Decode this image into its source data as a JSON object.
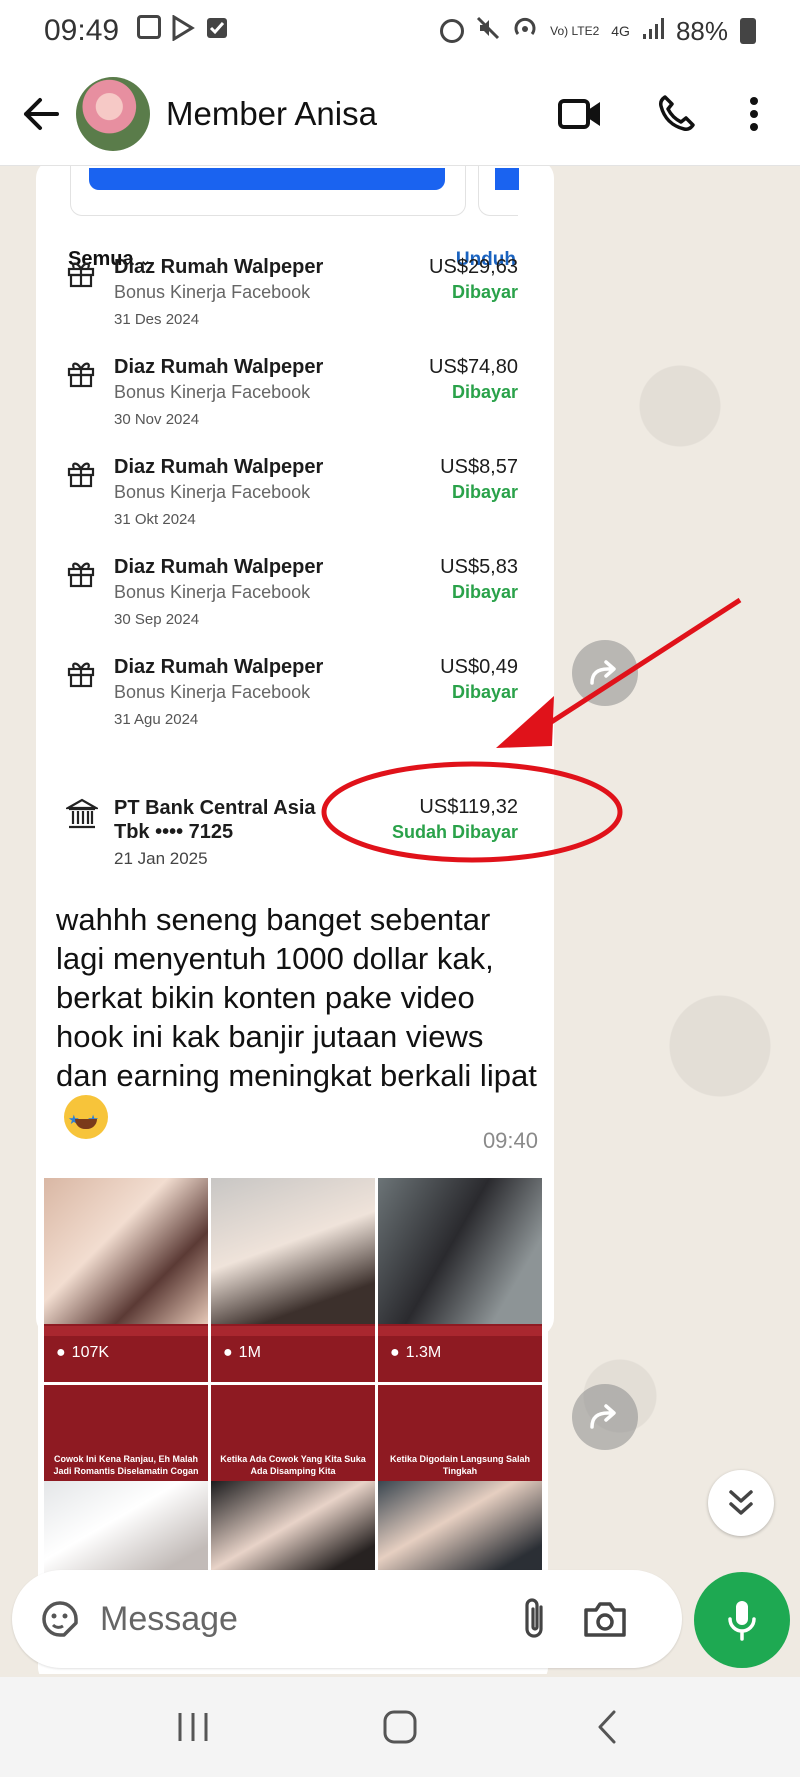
{
  "status_bar": {
    "time": "09:49",
    "network": "Vo) LTE2",
    "network_type": "4G",
    "battery": "88%"
  },
  "header": {
    "contact_name": "Member Anisa"
  },
  "shared_screenshot": {
    "filter_label": "Semua",
    "download_label": "Unduh",
    "transactions": [
      {
        "name": "Diaz Rumah Walpeper",
        "subtitle": "Bonus Kinerja Facebook",
        "date": "31 Des 2024",
        "amount": "US$29,63",
        "status": "Dibayar"
      },
      {
        "name": "Diaz Rumah Walpeper",
        "subtitle": "Bonus Kinerja Facebook",
        "date": "30 Nov 2024",
        "amount": "US$74,80",
        "status": "Dibayar"
      },
      {
        "name": "Diaz Rumah Walpeper",
        "subtitle": "Bonus Kinerja Facebook",
        "date": "31 Okt 2024",
        "amount": "US$8,57",
        "status": "Dibayar"
      },
      {
        "name": "Diaz Rumah Walpeper",
        "subtitle": "Bonus Kinerja Facebook",
        "date": "30 Sep 2024",
        "amount": "US$5,83",
        "status": "Dibayar"
      },
      {
        "name": "Diaz Rumah Walpeper",
        "subtitle": "Bonus Kinerja Facebook",
        "date": "31 Agu 2024",
        "amount": "US$0,49",
        "status": "Dibayar"
      }
    ],
    "payout": {
      "name": "PT Bank Central Asia Tbk •••• 7125",
      "date": "21 Jan 2025",
      "amount": "US$119,32",
      "status": "Sudah Dibayar"
    }
  },
  "message": {
    "text": "wahhh seneng banget sebentar lagi menyentuh 1000 dollar kak, berkat bikin konten pake video hook ini kak banjir jutaan views dan earning meningkat berkali lipat",
    "time": "09:40"
  },
  "image_grid": {
    "top_row_views": [
      "107K",
      "1M",
      "1.3M"
    ],
    "bottom_row_captions": [
      "Cowok Ini Kena Ranjau, Eh Malah Jadi Romantis Diselamatin Cogan",
      "Ketika Ada Cowok Yang Kita Suka Ada Disamping Kita",
      "Ketika Digodain Langsung Salah Tingkah"
    ]
  },
  "composer": {
    "placeholder": "Message"
  },
  "colors": {
    "accent_green": "#1ea952",
    "paid_green": "#2aa24a",
    "link_blue": "#1a63c0",
    "annotation_red": "#e0121a"
  }
}
